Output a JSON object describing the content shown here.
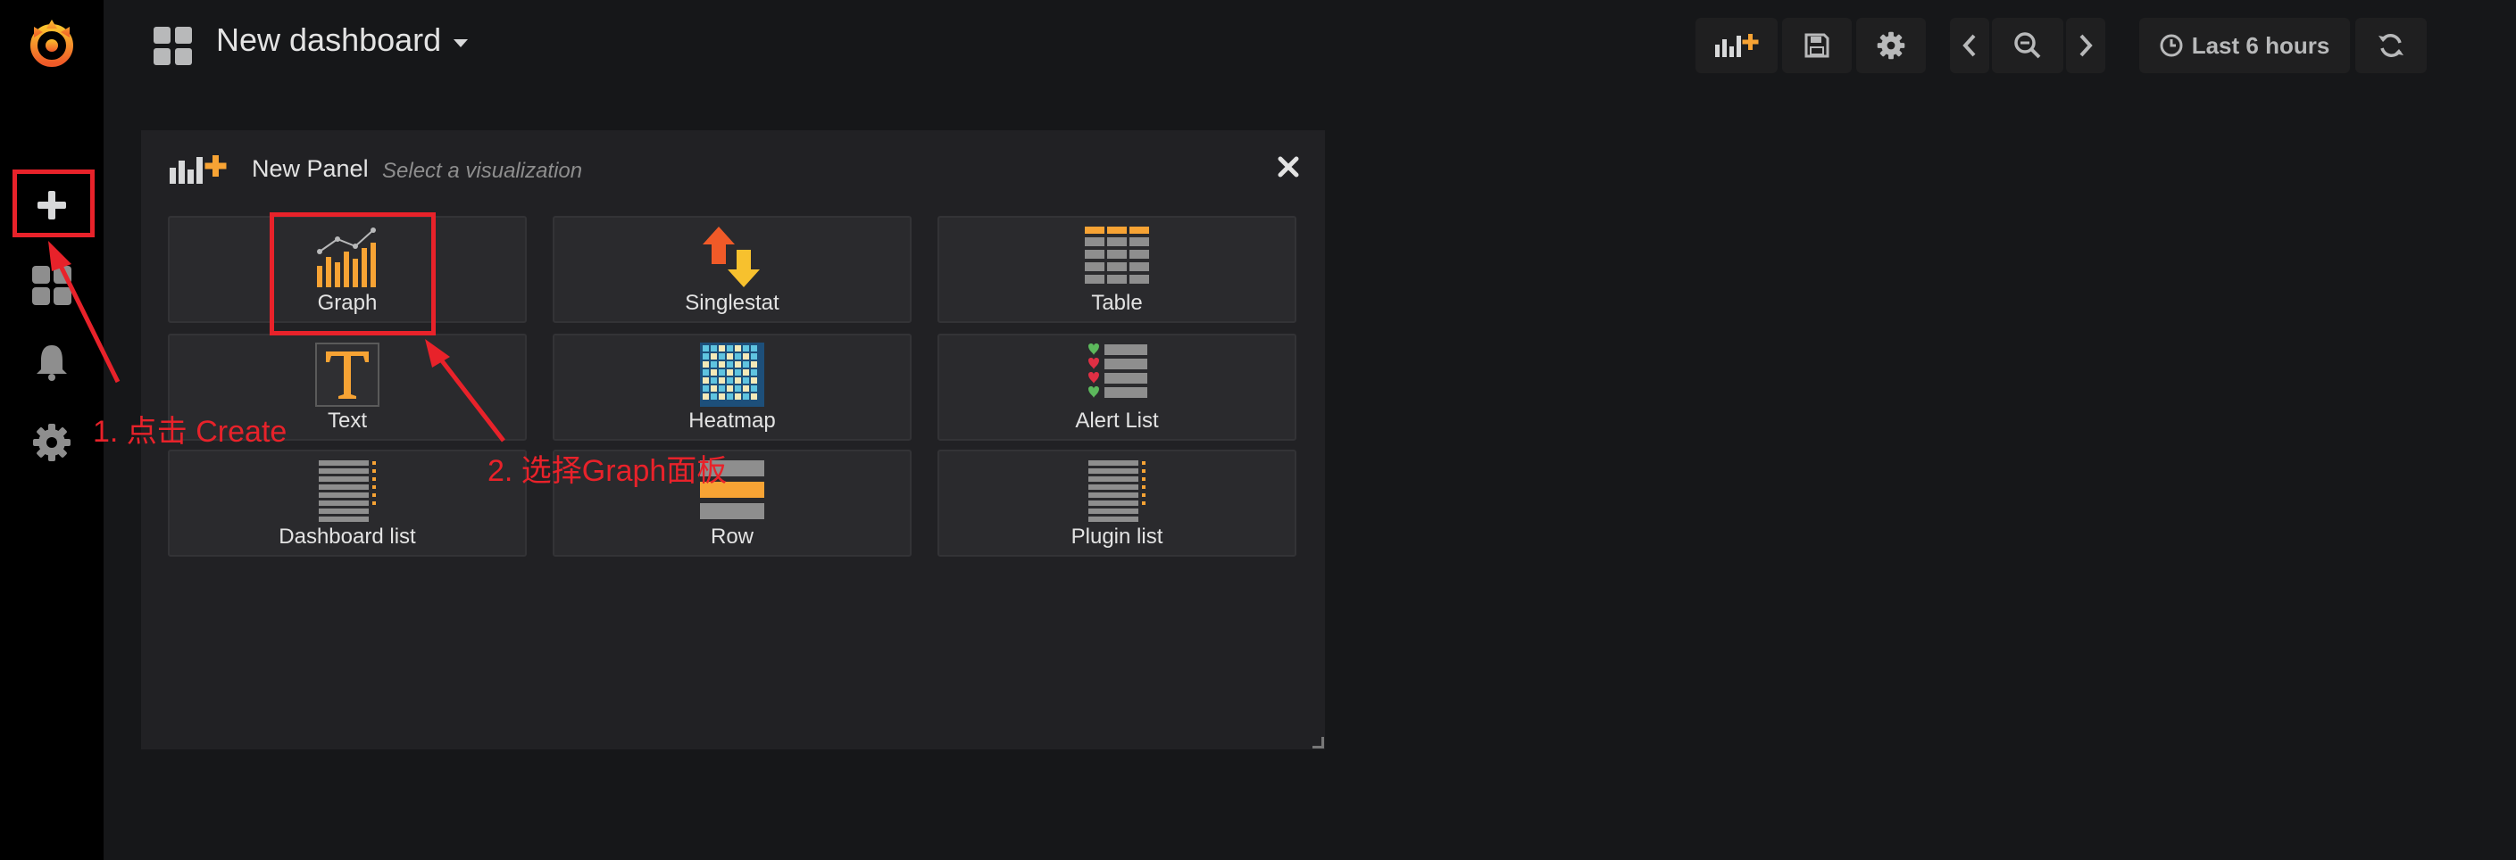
{
  "navbar": {
    "title": "New dashboard",
    "time_range": "Last 6 hours",
    "icons": [
      "add-panel-icon",
      "save-icon",
      "gear-icon",
      "chevron-left-icon",
      "zoom-out-icon",
      "chevron-right-icon",
      "clock-icon",
      "refresh-icon"
    ]
  },
  "sidebar": {
    "items": [
      {
        "name": "grafana-logo"
      },
      {
        "name": "create",
        "icon": "plus-icon"
      },
      {
        "name": "dashboards",
        "icon": "dashboards-icon"
      },
      {
        "name": "alerting",
        "icon": "bell-icon"
      },
      {
        "name": "configuration",
        "icon": "cog-icon"
      }
    ]
  },
  "panel": {
    "title": "New Panel",
    "subtitle": "Select a visualization",
    "visualizations": [
      {
        "label": "Graph",
        "icon": "graph-icon"
      },
      {
        "label": "Singlestat",
        "icon": "singlestat-icon"
      },
      {
        "label": "Table",
        "icon": "table-icon"
      },
      {
        "label": "Text",
        "icon": "text-icon"
      },
      {
        "label": "Heatmap",
        "icon": "heatmap-icon"
      },
      {
        "label": "Alert List",
        "icon": "alert-list-icon"
      },
      {
        "label": "Dashboard list",
        "icon": "dashboard-list-icon"
      },
      {
        "label": "Row",
        "icon": "row-icon"
      },
      {
        "label": "Plugin list",
        "icon": "plugin-list-icon"
      }
    ]
  },
  "annotations": {
    "step1": "1. 点击 Create",
    "step2": "2. 选择Graph面板"
  },
  "colors": {
    "background": "#161719",
    "sidebar": "#000000",
    "panel": "#212124",
    "tile": "#2a2a2d",
    "accent_orange": "#f7a334",
    "annotation_red": "#e8222a"
  }
}
